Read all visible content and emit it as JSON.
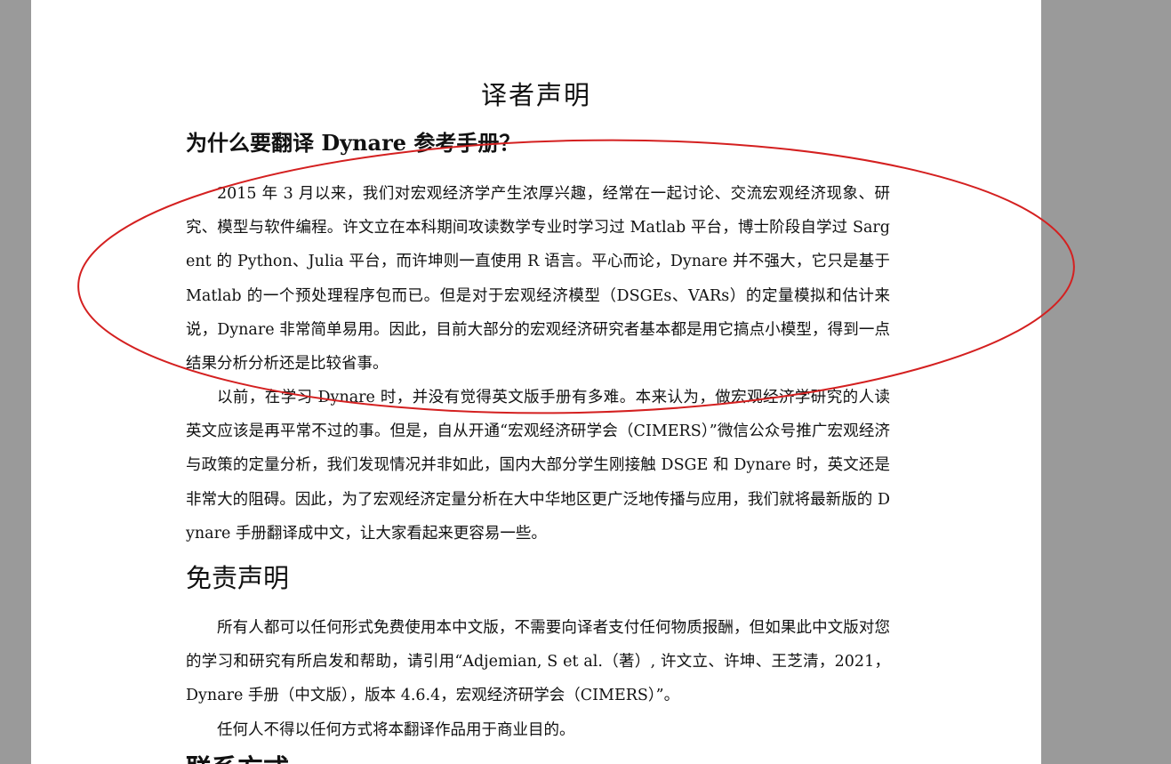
{
  "document": {
    "title": "译者声明",
    "section1_heading": "为什么要翻译 Dynare 参考手册？",
    "para1": "2015 年 3 月以来，我们对宏观经济学产生浓厚兴趣，经常在一起讨论、交流宏观经济现象、研究、模型与软件编程。许文立在本科期间攻读数学专业时学习过 Matlab 平台，博士阶段自学过 Sargent 的 Python、Julia 平台，而许坤则一直使用 R 语言。平心而论，Dynare 并不强大，它只是基于 Matlab 的一个预处理程序包而已。但是对于宏观经济模型（DSGEs、VARs）的定量模拟和估计来说，Dynare 非常简单易用。因此，目前大部分的宏观经济研究者基本都是用它搞点小模型，得到一点结果分析分析还是比较省事。",
    "para2": "以前，在学习 Dynare 时，并没有觉得英文版手册有多难。本来认为，做宏观经济学研究的人读英文应该是再平常不过的事。但是，自从开通“宏观经济研学会（CIMERS）”微信公众号推广宏观经济与政策的定量分析，我们发现情况并非如此，国内大部分学生刚接触 DSGE 和 Dynare 时，英文还是非常大的阻碍。因此，为了宏观经济定量分析在大中华地区更广泛地传播与应用，我们就将最新版的 Dynare 手册翻译成中文，让大家看起来更容易一些。",
    "section2_heading": "免责声明",
    "para3": "所有人都可以任何形式免费使用本中文版，不需要向译者支付任何物质报酬，但如果此中文版对您的学习和研究有所启发和帮助，请引用“Adjemian, S et al.（著）, 许文立、许坤、王芝清，2021，Dynare 手册（中文版），版本 4.6.4，宏观经济研学会（CIMERS）”。",
    "para4": "任何人不得以任何方式将本翻译作品用于商业目的。",
    "section3_heading": "联系方式"
  },
  "colors": {
    "viewer_background": "#9a9a9a",
    "page": "#ffffff",
    "annotation": "#d42020"
  }
}
